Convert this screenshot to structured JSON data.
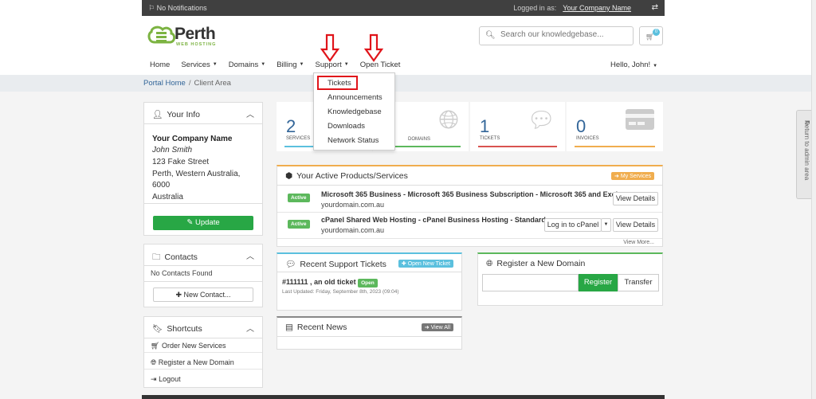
{
  "topbar": {
    "notifications": "No Notifications",
    "logged_in_label": "Logged in as:",
    "company": "Your Company Name"
  },
  "logo": {
    "name": "Perth",
    "tagline": "WEB HOSTING"
  },
  "search": {
    "placeholder": "Search our knowledgebase..."
  },
  "cart": {
    "count": "0"
  },
  "nav": {
    "home": "Home",
    "services": "Services",
    "domains": "Domains",
    "billing": "Billing",
    "support": "Support",
    "open_ticket": "Open Ticket",
    "hello": "Hello, John!"
  },
  "breadcrumb": {
    "home": "Portal Home",
    "separator": "/",
    "current": "Client Area"
  },
  "support_dropdown": [
    "Tickets",
    "Announcements",
    "Knowledgebase",
    "Downloads",
    "Network Status"
  ],
  "your_info": {
    "title": "Your Info",
    "company": "Your Company Name",
    "name": "John Smith",
    "address_lines": [
      "123 Fake Street",
      "Perth, Western Australia,",
      "6000",
      "Australia"
    ],
    "update_label": "Update"
  },
  "contacts": {
    "title": "Contacts",
    "empty": "No Contacts Found",
    "new_label": "New Contact..."
  },
  "shortcuts": {
    "title": "Shortcuts",
    "items": [
      "Order New Services",
      "Register a New Domain",
      "Logout"
    ]
  },
  "stats": [
    {
      "value": "2",
      "label": "SERVICES",
      "color": "#5bc0de"
    },
    {
      "value": "",
      "label": "DOMAINS",
      "color": "#5cb85c"
    },
    {
      "value": "1",
      "label": "TICKETS",
      "color": "#d9534f"
    },
    {
      "value": "0",
      "label": "INVOICES",
      "color": "#f0ad4e"
    }
  ],
  "products": {
    "title": "Your Active Products/Services",
    "my_services_label": "My Services",
    "rows": [
      {
        "status": "Active",
        "name": "Microsoft 365 Business - Microsoft 365 Business Subscription - Microsoft 365 and Exch...",
        "domain": "yourdomain.com.au",
        "action1": "View Details"
      },
      {
        "status": "Active",
        "name": "cPanel Shared Web Hosting - cPanel Business Hosting - Standard ...",
        "domain": "yourdomain.com.au",
        "action1": "Log in to cPanel",
        "action2": "View Details"
      }
    ],
    "view_more": "View More..."
  },
  "tickets": {
    "title": "Recent Support Tickets",
    "new_label": "Open New Ticket",
    "item_title": "#111111 , an old ticket",
    "item_status": "Open",
    "item_updated": "Last Updated: Friday, September 8th, 2023 (09:04)"
  },
  "register_domain": {
    "title": "Register a New Domain",
    "register_label": "Register",
    "transfer_label": "Transfer"
  },
  "news": {
    "title": "Recent News",
    "view_all_label": "View All"
  },
  "side_tab": {
    "label": "Return to admin area"
  },
  "colors": {
    "brand_green": "#7cb342",
    "link_blue": "#336699",
    "annotation_red": "#e0141a"
  }
}
